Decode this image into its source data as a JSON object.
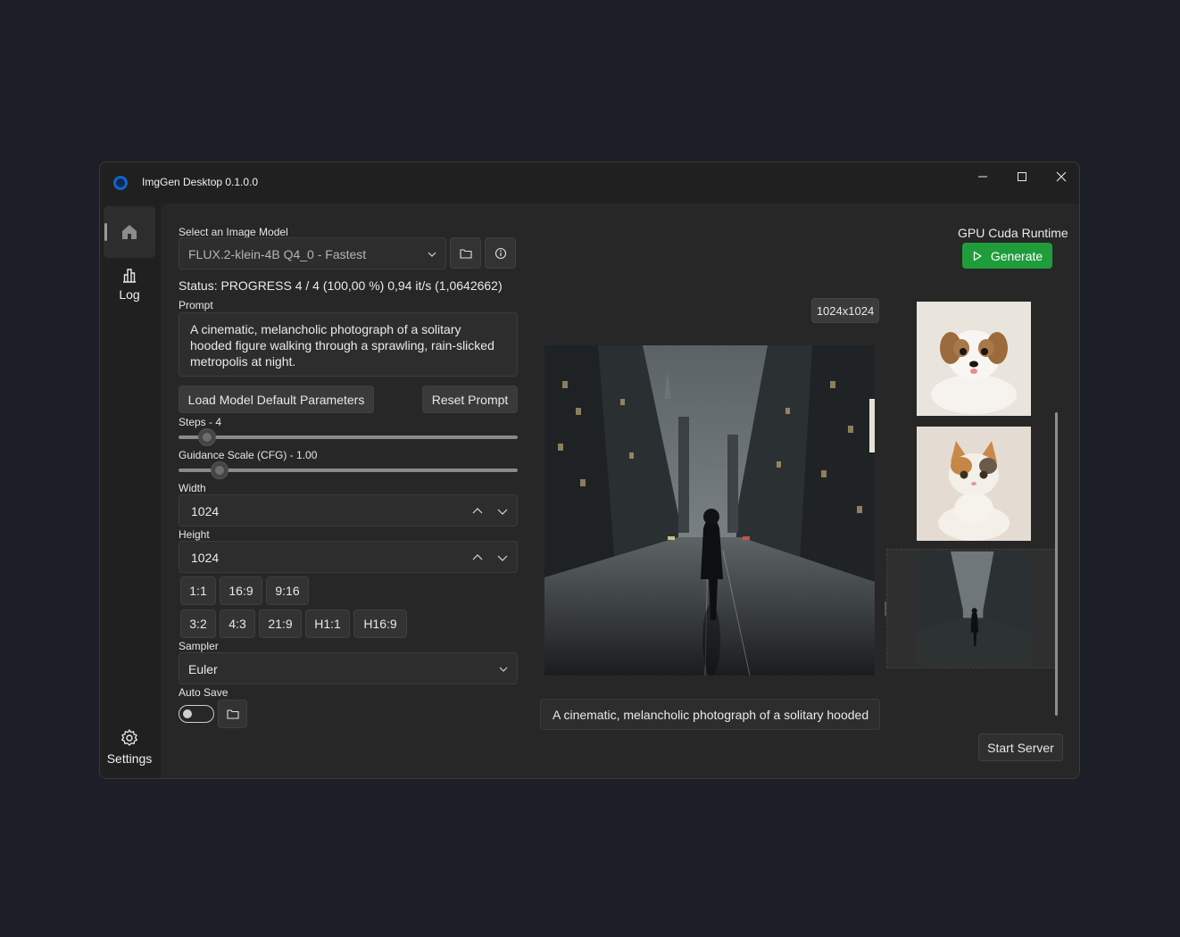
{
  "window": {
    "title": "ImgGen Desktop 0.1.0.0"
  },
  "sidebar": {
    "home_label": "",
    "log_label": "Log",
    "settings_label": "Settings"
  },
  "model": {
    "label": "Select an Image Model",
    "selected": "FLUX.2-klein-4B Q4_0 - Fastest",
    "status": "Status: PROGRESS 4 / 4 (100,00 %) 0,94 it/s (1,0642662)"
  },
  "prompt": {
    "label": "Prompt",
    "text": "A cinematic, melancholic photograph of a solitary hooded figure walking through a sprawling, rain-slicked metropolis at night."
  },
  "buttons": {
    "load_defaults": "Load Model Default Parameters",
    "reset_prompt": "Reset Prompt",
    "generate": "Generate",
    "start_server": "Start Server"
  },
  "steps": {
    "label": "Steps - 4",
    "value": 4,
    "min": 1,
    "max": 50
  },
  "cfg": {
    "label": "Guidance Scale (CFG) - 1.00",
    "value": 1.0,
    "min": 0,
    "max": 10
  },
  "width": {
    "label": "Width",
    "value": "1024"
  },
  "height": {
    "label": "Height",
    "value": "1024"
  },
  "ratios_row1": [
    "1:1",
    "16:9",
    "9:16"
  ],
  "ratios_row2": [
    "3:2",
    "4:3",
    "21:9",
    "H1:1",
    "H16:9"
  ],
  "sampler": {
    "label": "Sampler",
    "value": "Euler"
  },
  "autosave": {
    "label": "Auto Save",
    "enabled": false
  },
  "runtime": {
    "label": "GPU Cuda Runtime"
  },
  "preview": {
    "size_badge": "1024x1024",
    "caption": "A cinematic, melancholic photograph of a solitary hooded"
  },
  "history": {
    "items": [
      "puppy",
      "kitten",
      "city-street"
    ]
  },
  "colors": {
    "accent": "#1f9d3a",
    "background": "#1c1f27",
    "panel": "#272727"
  }
}
